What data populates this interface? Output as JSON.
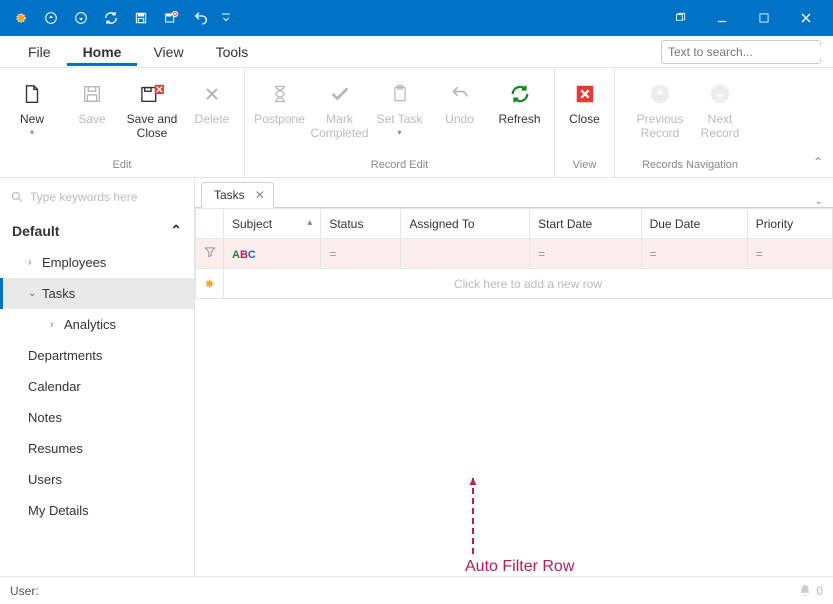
{
  "menubar": {
    "items": [
      "File",
      "Home",
      "View",
      "Tools"
    ],
    "active_index": 1,
    "search_placeholder": "Text to search..."
  },
  "ribbon": {
    "groups": [
      {
        "label": "Edit",
        "buttons": [
          {
            "name": "new-button",
            "label": "New",
            "enabled": true,
            "dropdown": true
          },
          {
            "name": "save-button",
            "label": "Save",
            "enabled": false
          },
          {
            "name": "save-close-button",
            "label": "Save and Close",
            "enabled": true
          },
          {
            "name": "delete-button",
            "label": "Delete",
            "enabled": false
          }
        ]
      },
      {
        "label": "Record Edit",
        "buttons": [
          {
            "name": "postpone-button",
            "label": "Postpone",
            "enabled": false
          },
          {
            "name": "mark-completed-button",
            "label": "Mark Completed",
            "enabled": false
          },
          {
            "name": "set-task-button",
            "label": "Set Task",
            "enabled": false,
            "dropdown": true
          },
          {
            "name": "undo-button",
            "label": "Undo",
            "enabled": false
          },
          {
            "name": "refresh-button",
            "label": "Refresh",
            "enabled": true
          }
        ]
      },
      {
        "label": "View",
        "buttons": [
          {
            "name": "close-button",
            "label": "Close",
            "enabled": true
          }
        ]
      },
      {
        "label": "Records Navigation",
        "buttons": [
          {
            "name": "prev-record-button",
            "label": "Previous Record",
            "enabled": false
          },
          {
            "name": "next-record-button",
            "label": "Next Record",
            "enabled": false
          }
        ]
      }
    ]
  },
  "sidebar": {
    "search_placeholder": "Type keywords here",
    "group": "Default",
    "nodes": [
      {
        "label": "Employees",
        "level": 1,
        "expandable": true,
        "expanded": false
      },
      {
        "label": "Tasks",
        "level": 1,
        "expandable": true,
        "expanded": true,
        "active": true
      },
      {
        "label": "Analytics",
        "level": 2,
        "expandable": true,
        "expanded": false
      },
      {
        "label": "Departments",
        "level": 0
      },
      {
        "label": "Calendar",
        "level": 0
      },
      {
        "label": "Notes",
        "level": 0
      },
      {
        "label": "Resumes",
        "level": 0
      },
      {
        "label": "Users",
        "level": 0
      },
      {
        "label": "My Details",
        "level": 0
      }
    ]
  },
  "tabs": [
    {
      "label": "Tasks",
      "closable": true
    }
  ],
  "grid": {
    "columns": [
      "Subject",
      "Status",
      "Assigned To",
      "Start Date",
      "Due Date",
      "Priority"
    ],
    "sort_column_index": 0,
    "filter_ops": [
      "abc",
      "=",
      "",
      "=",
      "=",
      "="
    ],
    "new_row_prompt": "Click here to add a new row"
  },
  "annotation": "Auto Filter Row",
  "status": {
    "user_label": "User:",
    "notifications": "0"
  }
}
